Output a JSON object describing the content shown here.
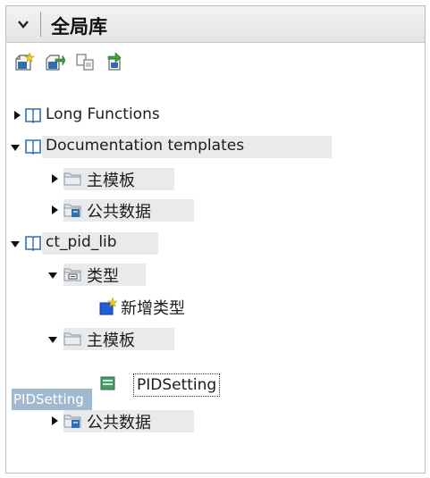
{
  "panel": {
    "title": "全局库"
  },
  "toolbar": {
    "buttons": [
      {
        "name": "create-new-library-icon"
      },
      {
        "name": "open-library-icon"
      },
      {
        "name": "save-library-icon"
      },
      {
        "name": "update-types-icon"
      }
    ]
  },
  "tree": {
    "long_functions": "Long Functions",
    "documentation_templates": "Documentation templates",
    "doc_master_copies": "主模板",
    "doc_common_data": "公共数据",
    "ct_pid_lib": "ct_pid_lib",
    "types": "类型",
    "add_new_type": "新增类型",
    "master_copies": "主模板",
    "pid_setting_item": "PIDSetting",
    "common_data": "公共数据"
  },
  "drag": {
    "ghost_label": "PIDSetting"
  },
  "colors": {
    "book_blue": "#2f6fb0",
    "folder_gold": "#e1b54a",
    "new_type_blue": "#1f5fd6",
    "new_star_yellow": "#f2d21a",
    "drag_ghost": "#8aa8c4"
  }
}
